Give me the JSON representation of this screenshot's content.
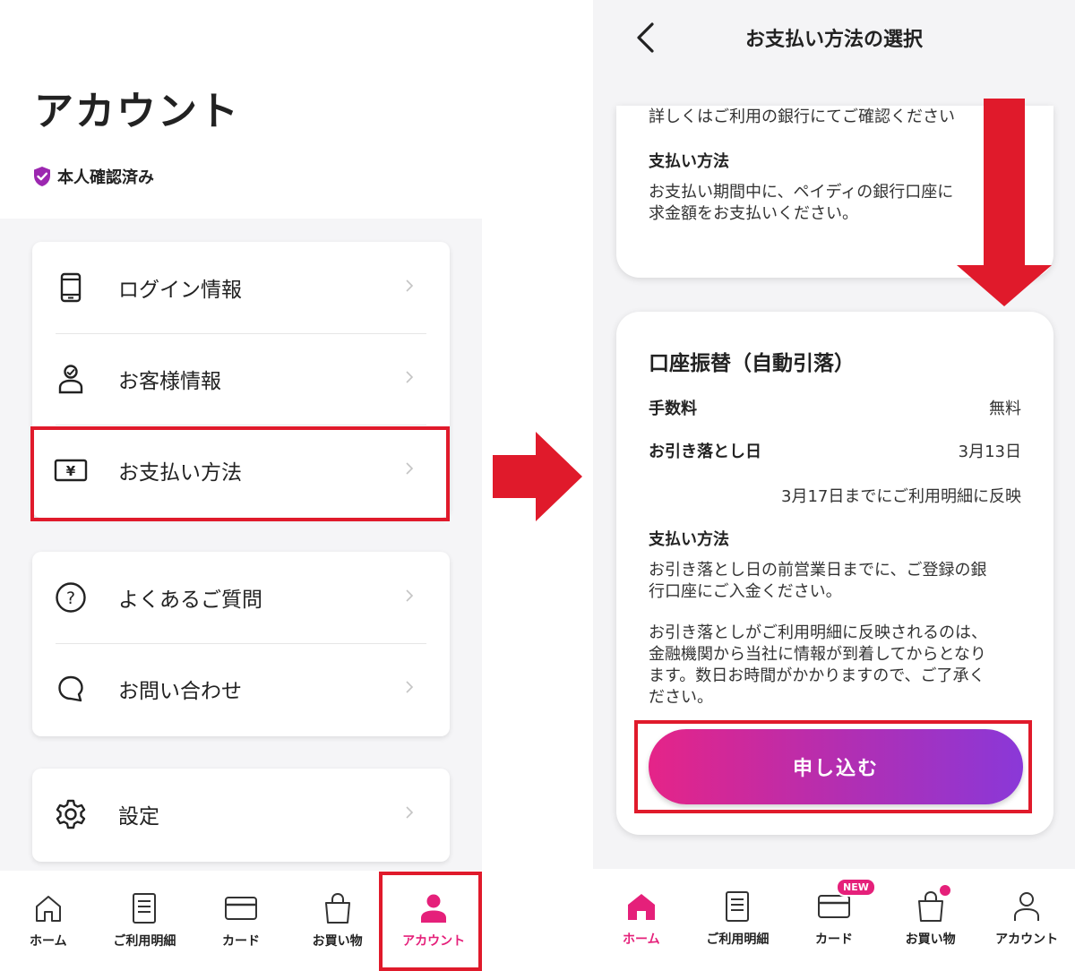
{
  "left": {
    "title": "アカウント",
    "verified_label": "本人確認済み",
    "menu_group1": [
      {
        "label": "ログイン情報",
        "icon": "phone-icon"
      },
      {
        "label": "お客様情報",
        "icon": "person-icon"
      },
      {
        "label": "お支払い方法",
        "icon": "yen-bill-icon"
      }
    ],
    "menu_group2": [
      {
        "label": "よくあるご質問",
        "icon": "question-icon"
      },
      {
        "label": "お問い合わせ",
        "icon": "chat-bubble-icon"
      }
    ],
    "menu_group3": [
      {
        "label": "設定",
        "icon": "gear-icon"
      }
    ],
    "nav": [
      {
        "label": "ホーム",
        "icon": "home-icon"
      },
      {
        "label": "ご利用明細",
        "icon": "statement-icon"
      },
      {
        "label": "カード",
        "icon": "card-icon"
      },
      {
        "label": "お買い物",
        "icon": "shopping-bag-icon"
      },
      {
        "label": "アカウント",
        "icon": "account-icon"
      }
    ]
  },
  "right": {
    "header_title": "お支払い方法の選択",
    "card1": {
      "top_text": "詳しくはご利用の銀行にてご確認ください",
      "heading": "支払い方法",
      "body_line1": "お支払い期間中に、ペイディの銀行口座に",
      "body_line2": "求金額をお支払いください。"
    },
    "card2": {
      "title": "口座振替（自動引落）",
      "fee_label": "手数料",
      "fee_value": "無料",
      "debit_label": "お引き落とし日",
      "debit_value": "3月13日",
      "reflect_note": "3月17日までにご利用明細に反映",
      "method_heading": "支払い方法",
      "method_line1": "お引き落とし日の前営業日までに、ご登録の銀",
      "method_line2": "行口座にご入金ください。",
      "note_line1": "お引き落としがご利用明細に反映されるのは、",
      "note_line2": "金融機関から当社に情報が到着してからとなり",
      "note_line3": "ます。数日お時間がかかりますので、ご了承く",
      "note_line4": "ださい。",
      "apply_label": "申し込む"
    },
    "nav": [
      {
        "label": "ホーム",
        "icon": "home-icon"
      },
      {
        "label": "ご利用明細",
        "icon": "statement-icon"
      },
      {
        "label": "カード",
        "icon": "card-icon",
        "badge": "NEW"
      },
      {
        "label": "お買い物",
        "icon": "shopping-bag-icon"
      },
      {
        "label": "アカウント",
        "icon": "account-icon"
      }
    ]
  },
  "colors": {
    "accent": "#e5207a",
    "highlight_red": "#e01a2b",
    "button_gradient_start": "#e52488",
    "button_gradient_end": "#8a38d8",
    "verified_shield": "#9c27b0"
  }
}
